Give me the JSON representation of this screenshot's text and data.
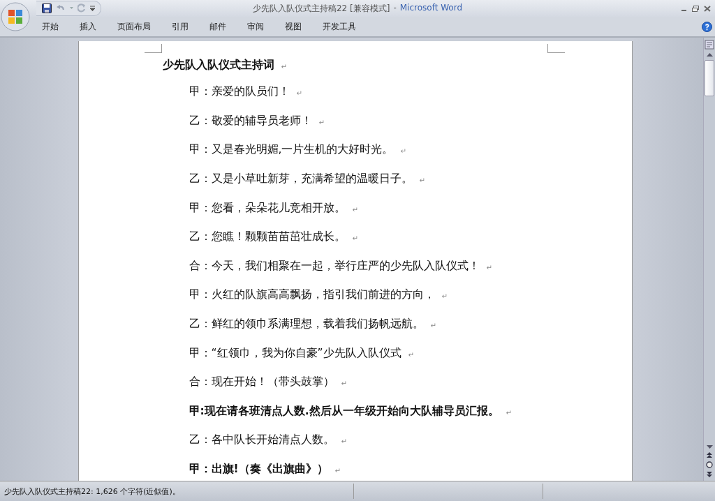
{
  "window": {
    "document_title": "少先队入队仪式主持稿22 [兼容模式]",
    "separator": "-",
    "app_name": "Microsoft Word"
  },
  "ribbon_tabs": [
    "开始",
    "插入",
    "页面布局",
    "引用",
    "邮件",
    "审阅",
    "视图",
    "开发工具"
  ],
  "document": {
    "paragraphs": [
      {
        "kind": "title",
        "text": "少先队入队仪式主持词",
        "bold": true,
        "mark": "↵"
      },
      {
        "kind": "line",
        "text": "甲：亲爱的队员们！",
        "bold": false,
        "mark": "↵"
      },
      {
        "kind": "line",
        "text": "乙：敬爱的辅导员老师！",
        "bold": false,
        "mark": "↵"
      },
      {
        "kind": "line",
        "text": "甲：又是春光明媚,一片生机的大好时光。",
        "bold": false,
        "mark": "↵"
      },
      {
        "kind": "line",
        "text": "乙：又是小草吐新芽，充满希望的温暖日子。",
        "bold": false,
        "mark": "↵"
      },
      {
        "kind": "line",
        "text": "甲：您看，朵朵花儿竞相开放。",
        "bold": false,
        "mark": "↵"
      },
      {
        "kind": "line",
        "text": "乙：您瞧！颗颗苗苗茁壮成长。",
        "bold": false,
        "mark": "↵"
      },
      {
        "kind": "line",
        "text": "合：今天，我们相聚在一起，举行庄严的少先队入队仪式！",
        "bold": false,
        "mark": "↵"
      },
      {
        "kind": "line",
        "text": "甲：火红的队旗高高飘扬，指引我们前进的方向，",
        "bold": false,
        "mark": "↵"
      },
      {
        "kind": "line",
        "text": "乙：鲜红的领巾系满理想，载着我们扬帆远航。",
        "bold": false,
        "mark": "↵"
      },
      {
        "kind": "line",
        "text": "甲：“红领巾，我为你自豪”少先队入队仪式",
        "bold": false,
        "mark": "↵"
      },
      {
        "kind": "line",
        "text": "合：现在开始！（带头鼓掌）",
        "bold": false,
        "mark": "↵"
      },
      {
        "kind": "line",
        "text": "甲:现在请各班清点人数.然后从一年级开始向大队辅导员汇报。",
        "bold": true,
        "mark": "↵"
      },
      {
        "kind": "line",
        "text": "乙：各中队长开始清点人数。",
        "bold": false,
        "mark": "↵"
      },
      {
        "kind": "line",
        "text": "甲：出旗!（奏《出旗曲》）",
        "bold": true,
        "mark": "↵"
      }
    ]
  },
  "status_bar": {
    "text": "少先队入队仪式主持稿22: 1,626 个字符(近似值)。"
  }
}
